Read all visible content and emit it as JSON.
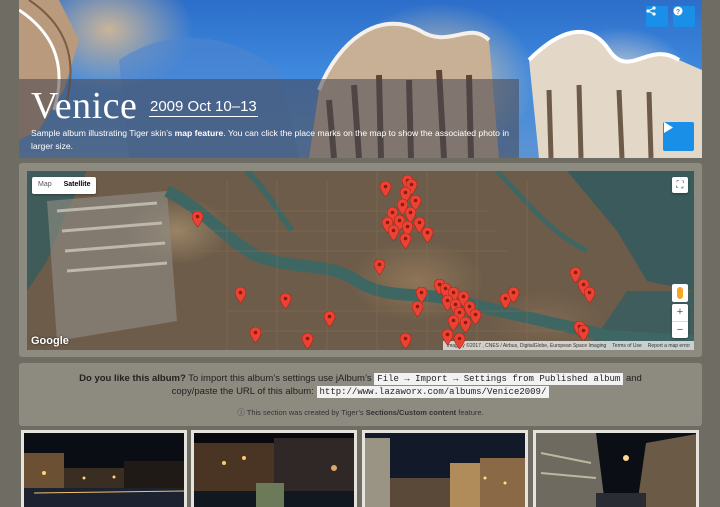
{
  "hero": {
    "title": "Venice",
    "date": "2009 Oct 10–13",
    "desc_pre": "Sample album illustrating Tiger skin’s ",
    "desc_bold": "map feature",
    "desc_post": ". You can click the place marks on the map to show the associated photo in larger size.",
    "share_icon": "share-icon",
    "help_icon": "help-icon",
    "play_icon": "play-icon",
    "accent_color": "#1a8fe8"
  },
  "map": {
    "tab_map": "Map",
    "tab_satellite": "Satellite",
    "logo": "Google",
    "zoom_in": "+",
    "zoom_out": "−",
    "attribution": "Imagery ©2017 , CNES / Airbus, DigitalGlobe, European Space Imaging",
    "terms": "Terms of Use",
    "report": "Report a map error",
    "pin_color": "#ea4335"
  },
  "info": {
    "q_bold": "Do you like this album?",
    "q_text": " To import this album’s settings use jAlbum’s ",
    "menu_path": "File → Import → Settings from Published album",
    "q_after": " and",
    "line2_pre": "copy/paste the URL of this album: ",
    "url": "http://www.lazaworx.com/albums/Venice2009/",
    "note_pre": "This section was created by Tiger’s ",
    "note_bold": "Sections/Custom content",
    "note_post": " feature."
  }
}
